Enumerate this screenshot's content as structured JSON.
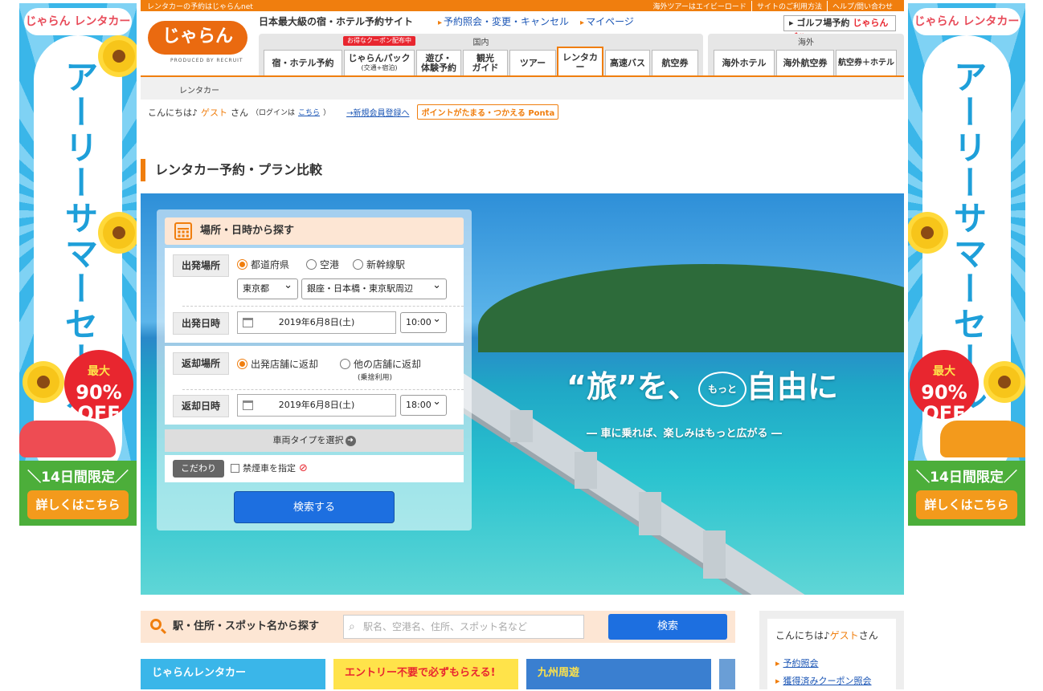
{
  "topbar": {
    "left": "レンタカーの予約はじゃらんnet",
    "links": [
      "海外ツアーはエイビーロード",
      "サイトのご利用方法",
      "ヘルプ/問い合わせ"
    ]
  },
  "header": {
    "logo": "じゃらん",
    "logo_sub": "PRODUCED BY RECRUIT",
    "tagline": "日本最大級の宿・ホテル予約サイト",
    "links": [
      "予約照会・変更・キャンセル",
      "マイページ"
    ],
    "golf_label": "ゴルフ場予約",
    "golf_brand": "じゃらんゴルフ"
  },
  "nav": {
    "domestic_label": "国内",
    "overseas_label": "海外",
    "coupon_badge": "お得なクーポン配布中",
    "tabs": [
      {
        "label": "宿・ホテル予約",
        "sub": ""
      },
      {
        "label": "じゃらんパック",
        "sub": "(交通+宿泊)"
      },
      {
        "label": "遊び・",
        "sub": "体験予約"
      },
      {
        "label": "観光",
        "sub": "ガイド"
      },
      {
        "label": "ツアー",
        "sub": ""
      },
      {
        "label": "レンタカー",
        "sub": ""
      },
      {
        "label": "高速バス",
        "sub": ""
      },
      {
        "label": "航空券",
        "sub": ""
      },
      {
        "label": "海外ホテル",
        "sub": ""
      },
      {
        "label": "海外航空券",
        "sub": ""
      },
      {
        "label": "航空券＋ホテル",
        "sub": ""
      }
    ]
  },
  "breadcrumb": "レンタカー",
  "greeting": {
    "hello": "こんにちは♪",
    "guest": "ゲスト",
    "san": "さん",
    "login_pre": "（ログインは",
    "login_link": "こちら",
    "login_post": "）",
    "register": "→新規会員登録へ",
    "ponta": "ポイントがたまる・つかえる Ponta"
  },
  "page_title": "レンタカー予約・プラン比較",
  "hero": {
    "catch_a": "“旅”を、",
    "catch_bubble": "もっと",
    "catch_b": "自由に",
    "subcatch": "― 車に乗れば、楽しみはもっと広がる ―"
  },
  "form": {
    "header": "場所・日時から探す",
    "departure_place_label": "出発場所",
    "place_options": [
      "都道府県",
      "空港",
      "新幹線駅"
    ],
    "prefecture": "東京都",
    "area": "銀座・日本橋・東京駅周辺",
    "departure_date_label": "出発日時",
    "departure_date": "2019年6月8日(土)",
    "departure_time": "10:00",
    "return_place_label": "返却場所",
    "return_options": [
      "出発店舗に返却",
      "他の店舗に返却"
    ],
    "return_note": "(乗捨利用)",
    "return_date_label": "返却日時",
    "return_date": "2019年6月8日(土)",
    "return_time": "18:00",
    "car_type": "車両タイプを選択",
    "kodawari": "こだわり",
    "nonsmoking": "禁煙車を指定",
    "search": "検索する"
  },
  "lower_search": {
    "label": "駅・住所・スポット名から探す",
    "placeholder": "駅名、空港名、住所、スポット名など",
    "button": "検索"
  },
  "sidebar_box": {
    "hello": "こんにちは♪",
    "guest": "ゲスト",
    "san": "さん",
    "links": [
      "予約照会",
      "獲得済みクーポン照会"
    ]
  },
  "side_ads": {
    "logo": "じゃらん レンタカー",
    "headline": "アーリーサマーセール",
    "max": "最大",
    "discount": "90%",
    "off": "OFF",
    "limit": "＼14日間限定／",
    "cta": "詳しくはこちら"
  },
  "bottom_banners": [
    "じゃらんレンタカー",
    "エントリー不要で必ずもらえる!",
    "九州周遊"
  ],
  "colors": {
    "brand_orange": "#f07e0e",
    "button_blue": "#1d6fe0",
    "link_blue": "#1a55b5"
  }
}
